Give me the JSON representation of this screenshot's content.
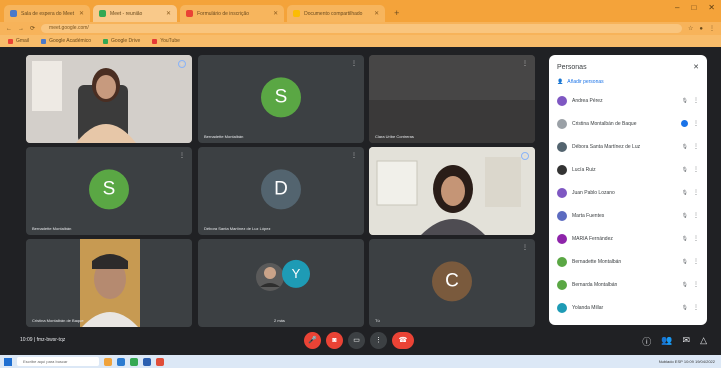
{
  "browser": {
    "tabs": [
      {
        "title": "Sala de espera do Meet",
        "color": "#4b79c9"
      },
      {
        "title": "Meet - reunião",
        "color": "#34a853"
      },
      {
        "title": "Formulário de inscrição",
        "color": "#ea4335"
      },
      {
        "title": "Documento compartilhado",
        "color": "#fbbc04"
      }
    ],
    "address": "meet.google.com/",
    "bookmarks": [
      "Gmail",
      "Google Académico",
      "Google Drive",
      "YouTube"
    ]
  },
  "stage": {
    "tiles": [
      {
        "kind": "video",
        "name": "",
        "pin_ring": true
      },
      {
        "kind": "avatar",
        "initial": "S",
        "color": "#5aa744",
        "name": "Bernadette Montalbán"
      },
      {
        "kind": "video",
        "name": "Clara Uribe Contreras"
      },
      {
        "kind": "avatar",
        "initial": "S",
        "color": "#5aa744",
        "name": "Bernadette Montalbán"
      },
      {
        "kind": "avatar",
        "initial": "D",
        "color": "#53646f",
        "name": "Débora Santa Martínez de Luz López"
      },
      {
        "kind": "video",
        "name": ""
      },
      {
        "kind": "video",
        "name": "Cristina Montalbán de Baque"
      },
      {
        "kind": "group",
        "initial": "Y",
        "color": "#1e9bb5",
        "name": "2 más"
      },
      {
        "kind": "avatar",
        "initial": "C",
        "color": "#7a5a3d",
        "name": "Tú"
      }
    ]
  },
  "panel": {
    "title": "Personas",
    "close_icon": "close-icon",
    "add_label": "Añadir personas",
    "participants": [
      {
        "name": "Andrea Pérez",
        "color": "#7e57c2"
      },
      {
        "name": "Cristina Montalbán de Baque",
        "color": "#9aa0a6"
      },
      {
        "name": "Débora Santa Martínez de Luz",
        "color": "#53646f"
      },
      {
        "name": "Lucía Ruiz",
        "color": "#333333"
      },
      {
        "name": "Juan Pablo Lozano",
        "color": "#7e57c2"
      },
      {
        "name": "Marta Fuentes",
        "color": "#5c6bc0"
      },
      {
        "name": "MARÍA Fernández",
        "color": "#8e24aa"
      },
      {
        "name": "Bernadette Montalbán",
        "color": "#5aa744"
      },
      {
        "name": "Bernarda Montalbán",
        "color": "#5aa744"
      },
      {
        "name": "Yolanda Millar",
        "color": "#1e9bb5"
      }
    ]
  },
  "bottom": {
    "meeting_time": "10:09",
    "meeting_code": "fmz-bwsr-tqz",
    "separator": "|",
    "end_label": "⌃"
  },
  "taskbar": {
    "search_placeholder": "Escribe aquí para buscar",
    "tray": "Nublado   ESP  10:09  19/04/2022"
  }
}
